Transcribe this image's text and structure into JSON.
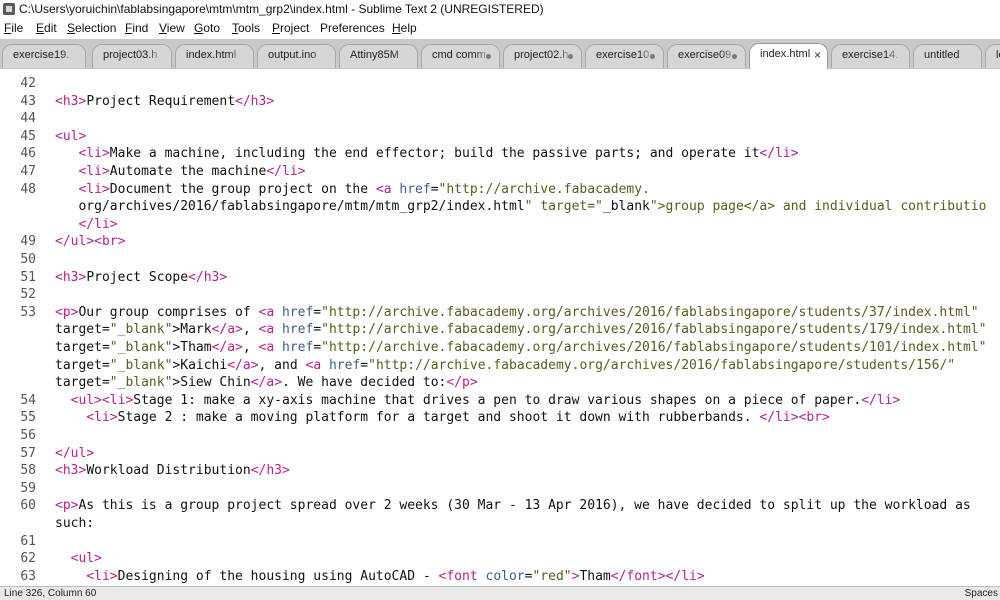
{
  "window": {
    "title": "C:\\Users\\yoruichin\\fablabsingapore\\mtm\\mtm_grp2\\index.html - Sublime Text 2 (UNREGISTERED)"
  },
  "menu": [
    {
      "u": "F",
      "rest": "ile"
    },
    {
      "u": "E",
      "rest": "dit"
    },
    {
      "u": "S",
      "rest": "election"
    },
    {
      "u": "F",
      "rest": "ind"
    },
    {
      "u": "V",
      "rest": "iew"
    },
    {
      "u": "G",
      "rest": "oto"
    },
    {
      "u": "T",
      "rest": "ools"
    },
    {
      "u": "P",
      "rest": "roject"
    },
    {
      "u": "",
      "rest": "Preferences"
    },
    {
      "u": "H",
      "rest": "elp"
    }
  ],
  "tabs": [
    {
      "label": "exercise19.",
      "active": false
    },
    {
      "label": "project03.h",
      "active": false
    },
    {
      "label": "index.html",
      "active": false
    },
    {
      "label": "output.ino",
      "active": false
    },
    {
      "label": "Attiny85M",
      "active": false
    },
    {
      "label": "cmd comm",
      "active": false
    },
    {
      "label": "project02.h",
      "active": false
    },
    {
      "label": "exercise10.",
      "active": false
    },
    {
      "label": "exercise09.",
      "active": false
    },
    {
      "label": "index.html",
      "active": true
    },
    {
      "label": "exercise14.",
      "active": false
    },
    {
      "label": "untitled",
      "active": false
    },
    {
      "label": "lo",
      "active": false
    }
  ],
  "active_tab_close": "×",
  "lines": [
    {
      "n": "42",
      "t": ""
    },
    {
      "n": "43",
      "t": "<h3>Project Requirement</h3>"
    },
    {
      "n": "44",
      "t": ""
    },
    {
      "n": "45",
      "t": "<ul>"
    },
    {
      "n": "46",
      "t": "   <li>Make a machine, including the end effector; build the passive parts; and operate it</li>"
    },
    {
      "n": "47",
      "t": "   <li>Automate the machine</li>"
    },
    {
      "n": "48",
      "t": "   <li>Document the group project on the <a href=\"http://archive.fabacademy."
    },
    {
      "n": "",
      "t": "   org/archives/2016/fablabsingapore/mtm/mtm_grp2/index.html\" target=\"_blank\">group page</a> and individual contributio"
    },
    {
      "n": "",
      "t": "   </li>"
    },
    {
      "n": "49",
      "t": "</ul><br>"
    },
    {
      "n": "50",
      "t": ""
    },
    {
      "n": "51",
      "t": "<h3>Project Scope</h3>"
    },
    {
      "n": "52",
      "t": ""
    },
    {
      "n": "53",
      "t": "<p>Our group comprises of <a href=\"http://archive.fabacademy.org/archives/2016/fablabsingapore/students/37/index.html\""
    },
    {
      "n": "",
      "t": "target=\"_blank\">Mark</a>, <a href=\"http://archive.fabacademy.org/archives/2016/fablabsingapore/students/179/index.html\""
    },
    {
      "n": "",
      "t": "target=\"_blank\">Tham</a>, <a href=\"http://archive.fabacademy.org/archives/2016/fablabsingapore/students/101/index.html\""
    },
    {
      "n": "",
      "t": "target=\"_blank\">Kaichi</a>, and <a href=\"http://archive.fabacademy.org/archives/2016/fablabsingapore/students/156/\""
    },
    {
      "n": "",
      "t": "target=\"_blank\">Siew Chin</a>. We have decided to:</p>"
    },
    {
      "n": "54",
      "t": "  <ul><li>Stage 1: make a xy-axis machine that drives a pen to draw various shapes on a piece of paper.</li>"
    },
    {
      "n": "55",
      "t": "    <li>Stage 2 : make a moving platform for a target and shoot it down with rubberbands. </li><br>"
    },
    {
      "n": "56",
      "t": ""
    },
    {
      "n": "57",
      "t": "</ul>"
    },
    {
      "n": "58",
      "t": "<h3>Workload Distribution</h3>"
    },
    {
      "n": "59",
      "t": ""
    },
    {
      "n": "60",
      "t": "<p>As this is a group project spread over 2 weeks (30 Mar - 13 Apr 2016), we have decided to split up the workload as"
    },
    {
      "n": "",
      "t": "such:"
    },
    {
      "n": "61",
      "t": ""
    },
    {
      "n": "62",
      "t": "  <ul>"
    },
    {
      "n": "63",
      "t": "    <li>Designing of the housing using AutoCAD - <font color=\"red\">Tham</font></li>"
    }
  ],
  "status": {
    "left": "Line 326, Column 60",
    "right": "Spaces"
  },
  "colors": {
    "tag": "#b5218c",
    "attr": "#3f5e8c",
    "string": "#5a5a22",
    "tabbar": "#c9c9c9"
  }
}
